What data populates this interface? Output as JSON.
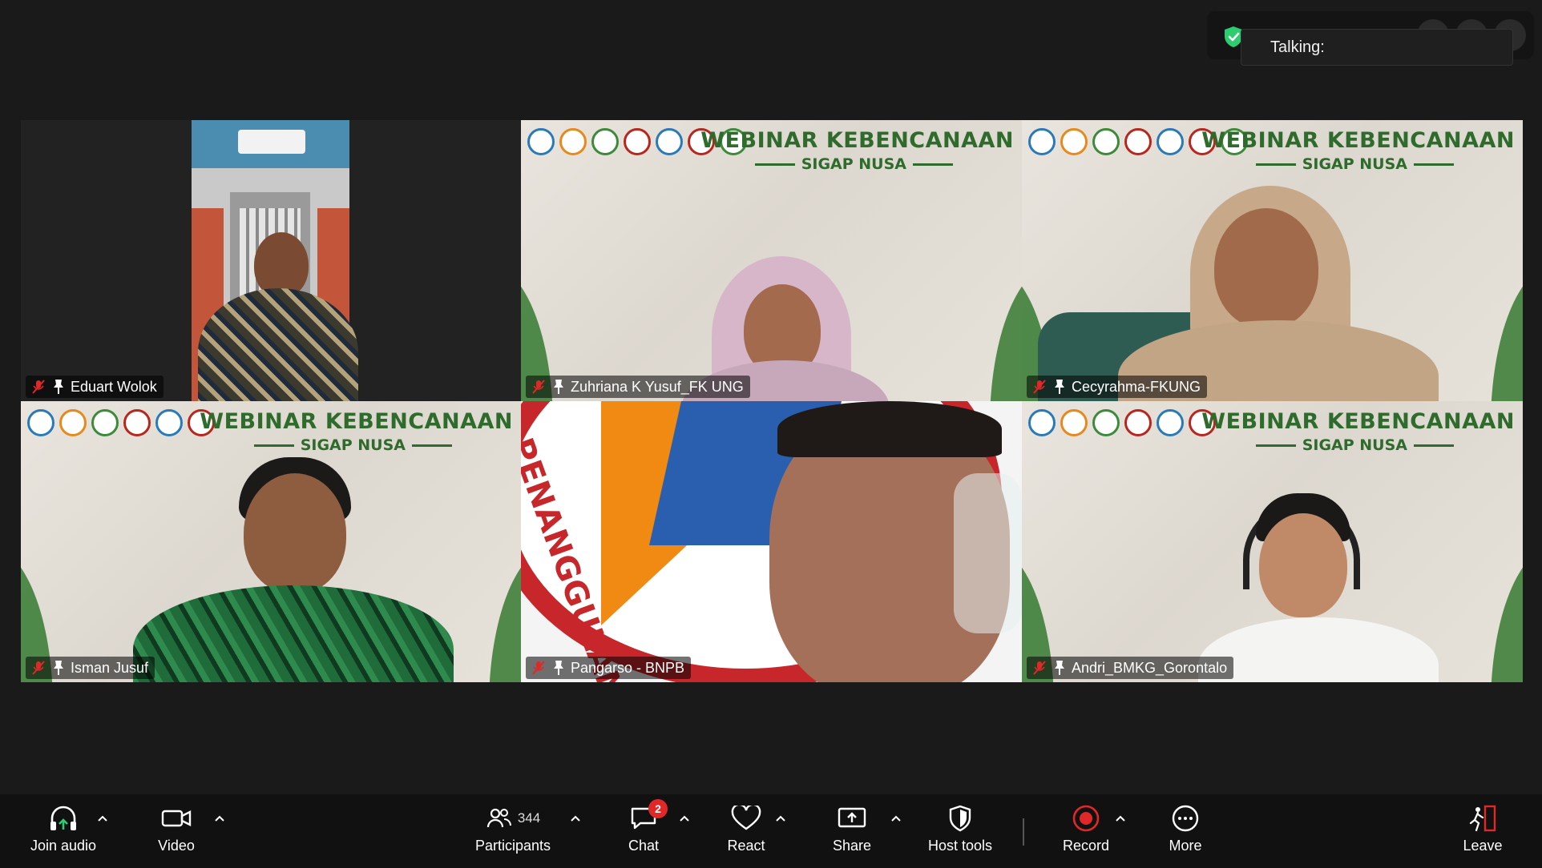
{
  "overlay": {
    "talking_text": "Talking:"
  },
  "tiles": [
    {
      "name": "Eduart Wolok"
    },
    {
      "name": "Zuhriana K Yusuf_FK UNG"
    },
    {
      "name": "Cecyrahma-FKUNG"
    },
    {
      "name": "Isman Jusuf"
    },
    {
      "name": "Pangarso - BNPB"
    },
    {
      "name": "Andri_BMKG_Gorontalo"
    }
  ],
  "webinar": {
    "title": "WEBINAR KEBENCANAAN",
    "subtitle": "SIGAP NUSA"
  },
  "bnpb_logo_text": "PENANGGULANG",
  "toolbar": {
    "join_audio": "Join audio",
    "video": "Video",
    "participants": "Participants",
    "participants_count": "344",
    "chat": "Chat",
    "chat_badge": "2",
    "react": "React",
    "share": "Share",
    "host_tools": "Host tools",
    "record": "Record",
    "more": "More",
    "leave": "Leave"
  },
  "colors": {
    "record_red": "#e02828",
    "leave_red": "#e02828",
    "webinar_green": "#2f6b2c",
    "shield_green": "#2ecc71"
  }
}
